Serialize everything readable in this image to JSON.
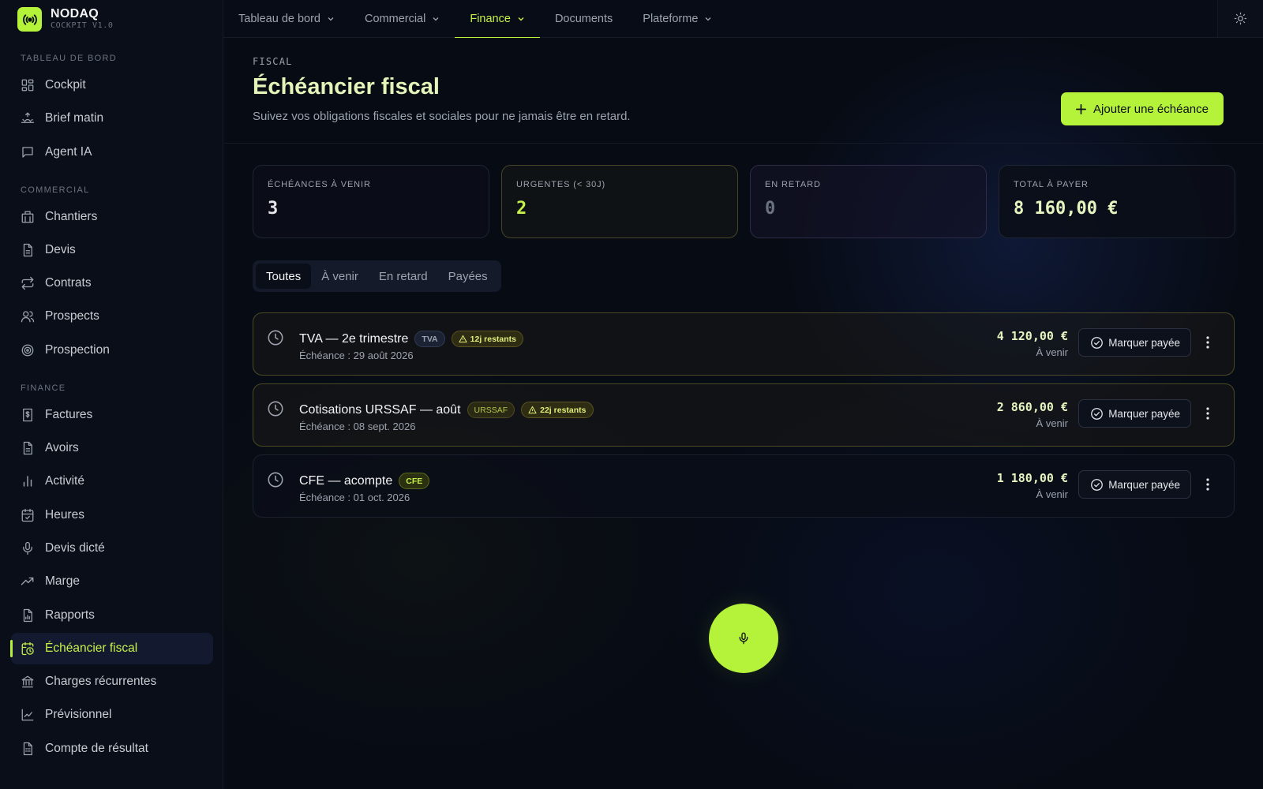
{
  "brand": {
    "name": "NODAQ",
    "subtitle": "COCKPIT V1.0",
    "accent": "#b5f23a"
  },
  "topnav": {
    "tabs": [
      {
        "label": "Tableau de bord",
        "has_menu": true
      },
      {
        "label": "Commercial",
        "has_menu": true
      },
      {
        "label": "Finance",
        "has_menu": true,
        "active": true
      },
      {
        "label": "Documents",
        "has_menu": false
      },
      {
        "label": "Plateforme",
        "has_menu": true
      }
    ]
  },
  "sidebar": {
    "sections": [
      {
        "title": "TABLEAU DE BORD",
        "items": [
          {
            "label": "Cockpit",
            "icon": "grid-icon"
          },
          {
            "label": "Brief matin",
            "icon": "sunrise-icon"
          },
          {
            "label": "Agent IA",
            "icon": "chat-icon"
          }
        ]
      },
      {
        "title": "COMMERCIAL",
        "items": [
          {
            "label": "Chantiers",
            "icon": "building-icon"
          },
          {
            "label": "Devis",
            "icon": "file-icon"
          },
          {
            "label": "Contrats",
            "icon": "repeat-icon"
          },
          {
            "label": "Prospects",
            "icon": "users-icon"
          },
          {
            "label": "Prospection",
            "icon": "target-icon"
          }
        ]
      },
      {
        "title": "FINANCE",
        "items": [
          {
            "label": "Factures",
            "icon": "invoice-icon"
          },
          {
            "label": "Avoirs",
            "icon": "file-icon"
          },
          {
            "label": "Activité",
            "icon": "bar-chart-icon"
          },
          {
            "label": "Heures",
            "icon": "calendar-check-icon"
          },
          {
            "label": "Devis dicté",
            "icon": "mic-icon"
          },
          {
            "label": "Marge",
            "icon": "trend-icon"
          },
          {
            "label": "Rapports",
            "icon": "report-icon"
          },
          {
            "label": "Échéancier fiscal",
            "icon": "calendar-clock-icon",
            "active": true
          },
          {
            "label": "Charges récurrentes",
            "icon": "bank-icon"
          },
          {
            "label": "Prévisionnel",
            "icon": "line-chart-icon"
          },
          {
            "label": "Compte de résultat",
            "icon": "ledger-icon"
          }
        ]
      }
    ]
  },
  "page": {
    "eyebrow": "FISCAL",
    "title": "Échéancier fiscal",
    "subtitle": "Suivez vos obligations fiscales et sociales pour ne jamais être en retard.",
    "add_label": "Ajouter une échéance"
  },
  "stats": [
    {
      "label": "ÉCHÉANCES À VENIR",
      "value": "3"
    },
    {
      "label": "URGENTES (< 30J)",
      "value": "2"
    },
    {
      "label": "EN RETARD",
      "value": "0"
    },
    {
      "label": "TOTAL À PAYER",
      "value": "8 160,00 €"
    }
  ],
  "filters": [
    "Toutes",
    "À venir",
    "En retard",
    "Payées"
  ],
  "deadlines": [
    {
      "title": "TVA — 2e trimestre",
      "tag": "TVA",
      "urgency": "12j restants",
      "date": "Échéance : 29 août 2026",
      "amount": "4 120,00 €",
      "status": "À venir"
    },
    {
      "title": "Cotisations URSSAF — août",
      "tag": "URSSAF",
      "urgency": "22j restants",
      "date": "Échéance : 08 sept. 2026",
      "amount": "2 860,00 €",
      "status": "À venir"
    },
    {
      "title": "CFE — acompte",
      "tag": "CFE",
      "date": "Échéance : 01 oct. 2026",
      "amount": "1 180,00 €",
      "status": "À venir"
    }
  ],
  "mark_paid_label": "Marquer payée"
}
